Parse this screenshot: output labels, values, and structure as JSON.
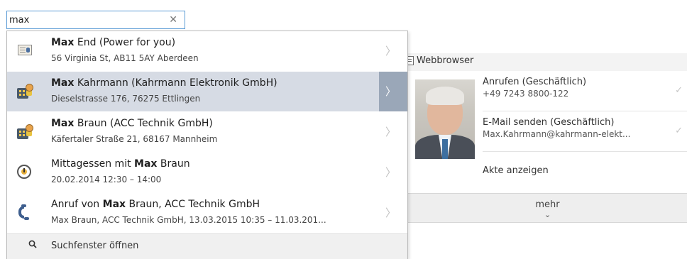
{
  "search": {
    "value": "max",
    "clear_glyph": "✕"
  },
  "background": {
    "toolbar": {
      "webbrowser_label": "Webbrowser"
    },
    "contact": {
      "actions": [
        {
          "title": "Anrufen (Geschäftlich)",
          "detail": "+49 7243 8800-122"
        },
        {
          "title": "E-Mail senden (Geschäftlich)",
          "detail": "Max.Kahrmann@kahrmann-elekt..."
        },
        {
          "title": "Akte anzeigen",
          "detail": ""
        }
      ],
      "more_label": "mehr"
    }
  },
  "dropdown": {
    "items": [
      {
        "icon": "contact-card-icon",
        "bold": "Max",
        "title_rest": " End (Power for you)",
        "subtitle": "56 Virginia St, AB11 5AY Aberdeen",
        "selected": false
      },
      {
        "icon": "company-contact-icon",
        "bold": "Max",
        "title_rest": " Kahrmann (Kahrmann Elektronik GmbH)",
        "subtitle": "Dieselstrasse 176, 76275 Ettlingen",
        "selected": true
      },
      {
        "icon": "company-contact-icon",
        "bold": "Max",
        "title_rest": " Braun (ACC Technik GmbH)",
        "subtitle": "Käfertaler Straße 21, 68167 Mannheim",
        "selected": false
      },
      {
        "icon": "appointment-clock-icon",
        "title_pre": "Mittagessen mit ",
        "bold": "Max",
        "title_rest": " Braun",
        "subtitle": "20.02.2014 12:30 – 14:00",
        "selected": false
      },
      {
        "icon": "phone-call-icon",
        "title_pre": "Anruf von ",
        "bold": "Max",
        "title_rest": " Braun, ACC Technik GmbH",
        "subtitle": "Max Braun, ACC Technik GmbH, 13.03.2015 10:35 – 11.03.201...",
        "selected": false
      }
    ],
    "footer_label": "Suchfenster öffnen"
  },
  "colors": {
    "search_border": "#5b9bd5",
    "selected_row": "#d6dbe4",
    "selected_arrow_box": "#9aa7b8"
  }
}
